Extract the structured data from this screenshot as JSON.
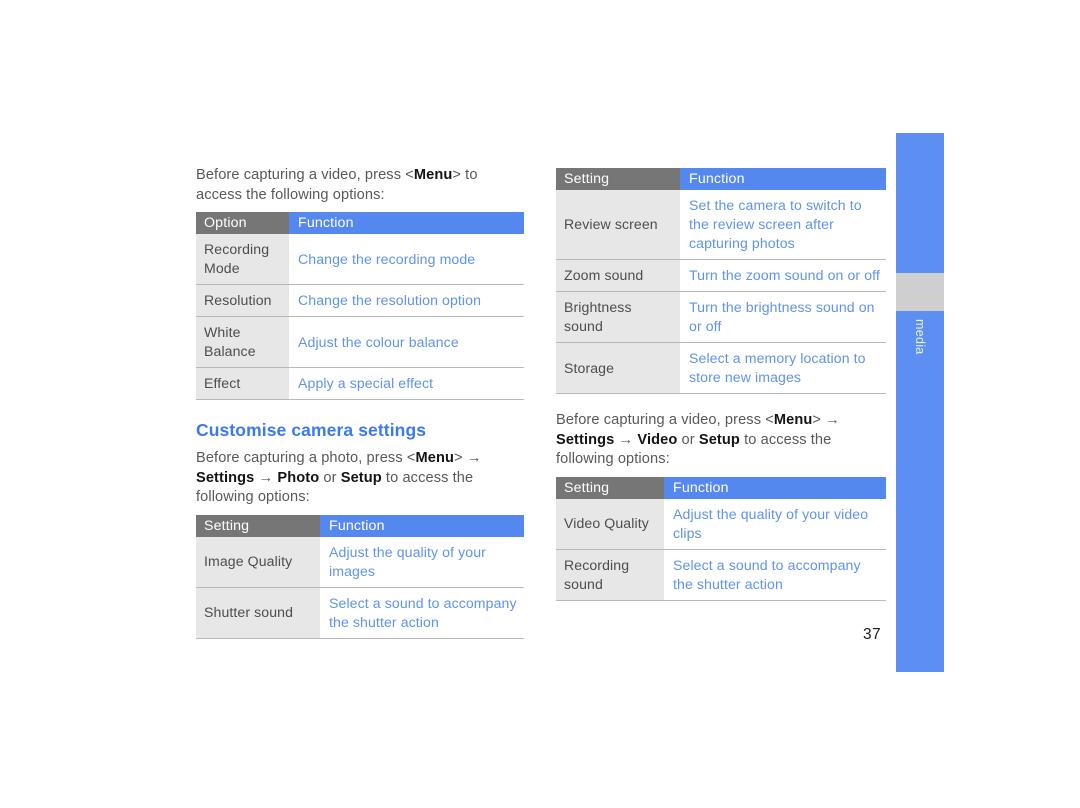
{
  "page": {
    "number": "37",
    "side_tab_label": "media",
    "accent_blue": "#5488ef",
    "header_gray": "#767676",
    "cell_gray": "#e7e7e7",
    "link_blue": "#5f93ec",
    "heading_blue": "#3b79ef"
  },
  "left_column": {
    "intro_video": {
      "part1": "Before capturing a video, press <",
      "bold1": "Menu",
      "part2": "> to access the following options:"
    },
    "video_options_table": {
      "headers": {
        "setting": "Option",
        "function": "Function"
      },
      "rows": [
        {
          "setting": "Recording Mode",
          "function": "Change the recording mode"
        },
        {
          "setting": "Resolution",
          "function": "Change the resolution option"
        },
        {
          "setting": "White Balance",
          "function": "Adjust the colour balance"
        },
        {
          "setting": "Effect",
          "function": "Apply a special effect"
        }
      ]
    },
    "heading": "Customise camera settings",
    "intro_photo": {
      "part1": "Before capturing a photo, press <",
      "bold1": "Menu",
      "part2": "> ",
      "arrow1": "→",
      "part3": " ",
      "bold2": "Settings",
      "arrow2": "→",
      "bold3": "Photo",
      "part4": " or ",
      "bold4": "Setup",
      "part5": " to access the following options:"
    },
    "photo_settings_table": {
      "headers": {
        "setting": "Setting",
        "function": "Function"
      },
      "rows": [
        {
          "setting": "Image Quality",
          "function": "Adjust the quality of your images"
        },
        {
          "setting": "Shutter sound",
          "function": "Select a sound to accompany the shutter action"
        }
      ]
    }
  },
  "right_column": {
    "photo_settings_table_cont": {
      "headers": {
        "setting": "Setting",
        "function": "Function"
      },
      "rows": [
        {
          "setting": "Review screen",
          "function": "Set the camera to switch to the review screen after capturing photos"
        },
        {
          "setting": "Zoom sound",
          "function": "Turn the zoom sound on or off"
        },
        {
          "setting": "Brightness sound",
          "function": "Turn the brightness sound on or off"
        },
        {
          "setting": "Storage",
          "function": "Select a memory location to store new images"
        }
      ]
    },
    "intro_video_settings": {
      "part1": "Before capturing a video, press <",
      "bold1": "Menu",
      "part2": "> ",
      "arrow1": "→",
      "bold2": "Settings",
      "arrow2": "→",
      "bold3": "Video",
      "part4": " or ",
      "bold4": "Setup",
      "part5": " to access the following options:"
    },
    "video_settings_table": {
      "headers": {
        "setting": "Setting",
        "function": "Function"
      },
      "rows": [
        {
          "setting": "Video Quality",
          "function": "Adjust the quality of your video clips"
        },
        {
          "setting": "Recording sound",
          "function": "Select a sound to accompany the shutter action"
        }
      ]
    }
  }
}
